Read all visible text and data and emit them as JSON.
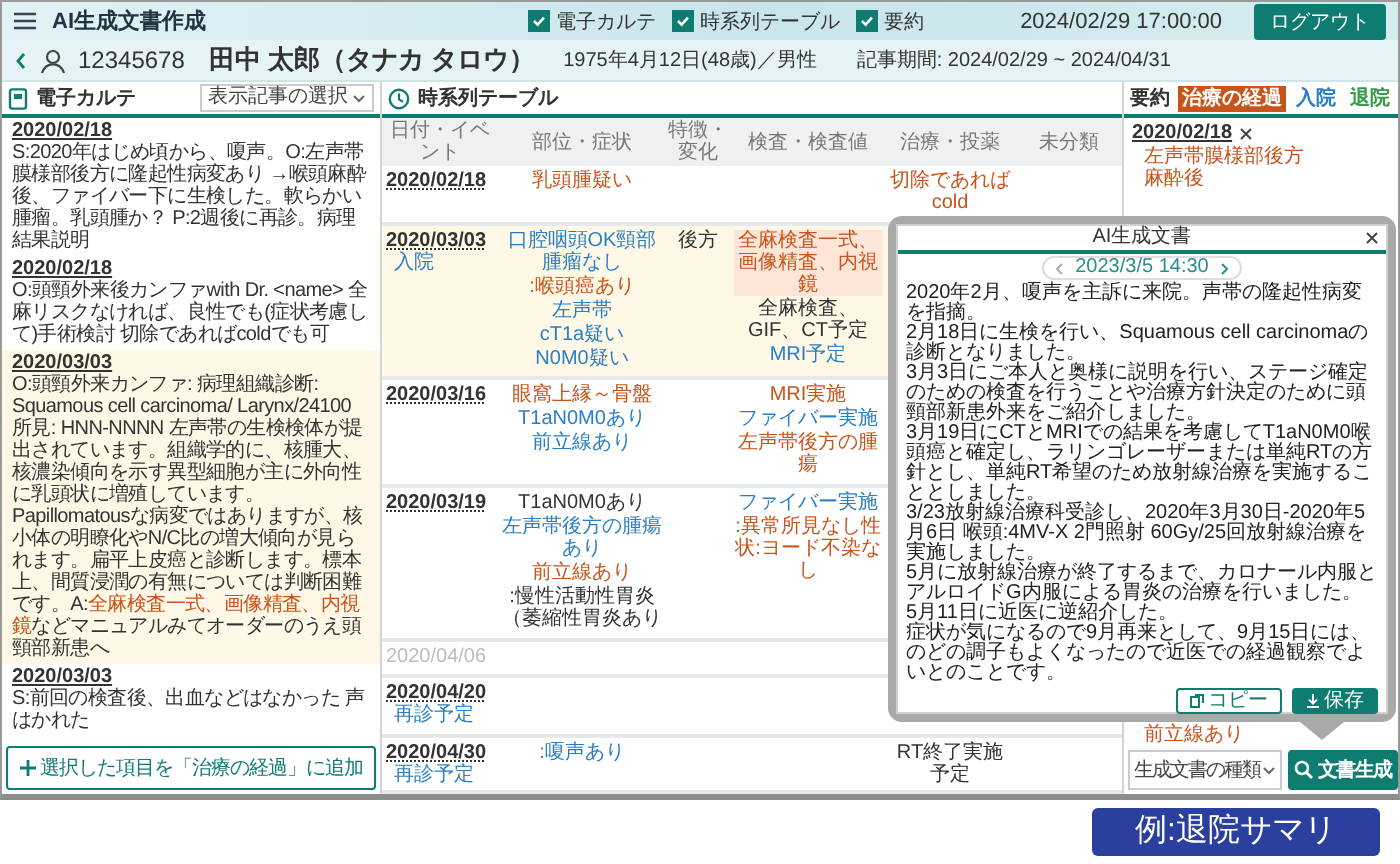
{
  "app_bar": {
    "title": "AI生成文書作成",
    "toggles": [
      {
        "label": "電子カルテ",
        "checked": true
      },
      {
        "label": "時系列テーブル",
        "checked": true
      },
      {
        "label": "要約",
        "checked": true
      }
    ],
    "datetime": "2024/02/29 17:00:00",
    "logout": "ログアウト"
  },
  "patient": {
    "id": "12345678",
    "name": "田中 太郎（タナカ タロウ）",
    "profile": "1975年4月12日(48歳)／男性",
    "period": "記事期間: 2024/02/29 ~ 2024/04/31"
  },
  "karte": {
    "title": "電子カルテ",
    "filter": "表示記事の選択",
    "entries": [
      {
        "date": "2020/02/18",
        "selected": false,
        "segments": [
          {
            "kind": "plain",
            "text": "S:2020年はじめ頃から、嗄声。O:左声帯膜様部後方に隆起性病変あり →喉頭麻酔後、ファイバー下に生検した。軟らかい腫瘤。乳頭腫か？ P:2週後に再診。病理結果説明"
          }
        ]
      },
      {
        "date": "2020/02/18",
        "selected": false,
        "segments": [
          {
            "kind": "plain",
            "text": "O:頭頸外来後カンファwith Dr. <name> 全麻リスクなければ、良性でも(症状考慮して)手術検討 切除であればcoldでも可"
          }
        ]
      },
      {
        "date": "2020/03/03",
        "selected": true,
        "segments": [
          {
            "kind": "plain",
            "text": "O:頭頸外来カンファ: 病理組織診断: Squamous cell carcinoma/ Larynx/24100 所見: HNN-NNNN 左声帯の生検検体が提出されています。組織学的に、核腫大、核濃染傾向を示す異型細胞が主に外向性に乳頭状に増殖しています。Papillomatousな病変ではありますが、核小体の明瞭化やN/C比の増大傾向が見られます。扁平上皮癌と診断します。標本上、間質浸潤の有無については判断困難です。A:"
          },
          {
            "kind": "alert",
            "text": "全麻検査一式、画像精査、内視鏡"
          },
          {
            "kind": "plain",
            "text": "などマニュアルみてオーダーのうえ頭頸部新患へ"
          }
        ]
      },
      {
        "date": "2020/03/03",
        "selected": false,
        "segments": [
          {
            "kind": "plain",
            "text": "S:前回の検査後、出血などはなかった 声はかれた"
          }
        ]
      }
    ],
    "add_button": "選択した項目を「治療の経過」に追加"
  },
  "timeline": {
    "title": "時系列テーブル",
    "columns": [
      "日付・イベント",
      "部位・症状",
      "特徴・変化",
      "検査・検査値",
      "治療・投薬",
      "未分類"
    ],
    "rows": [
      {
        "date": "2020/02/18",
        "selected": false,
        "faded": false,
        "site": [
          {
            "kind": "alert",
            "text": "乳頭腫疑い"
          }
        ],
        "treatment": [
          {
            "kind": "alert",
            "text": "切除であれば cold"
          }
        ]
      },
      {
        "date": "2020/03/03",
        "event": "入院",
        "selected": true,
        "faded": false,
        "site": [
          {
            "kind": "info",
            "text": "口腔咽頭OK頸部腫瘤なし"
          },
          {
            "kind": "alert",
            "text": ":喉頭癌あり"
          },
          {
            "kind": "info",
            "text": "左声帯"
          },
          {
            "kind": "info",
            "text": "cT1a疑い"
          },
          {
            "kind": "info",
            "text": "N0M0疑い"
          }
        ],
        "feature": [
          {
            "kind": "plain",
            "text": "後方"
          }
        ],
        "exam": [
          {
            "kind": "marked",
            "text": "全麻検査一式、画像精査、内視鏡"
          },
          {
            "kind": "plain",
            "text": "全麻検査、GIF、CT予定"
          },
          {
            "kind": "info",
            "text": "MRI予定"
          }
        ]
      },
      {
        "date": "2020/03/16",
        "selected": false,
        "faded": false,
        "site": [
          {
            "kind": "alert",
            "text": "眼窩上縁～骨盤"
          },
          {
            "kind": "info",
            "text": "T1aN0M0あり"
          },
          {
            "kind": "info",
            "text": "前立線あり"
          }
        ],
        "exam": [
          {
            "kind": "alert",
            "text": "MRI実施"
          },
          {
            "kind": "info",
            "text": "ファイバー実施"
          },
          {
            "kind": "alert",
            "text": "左声帯後方の腫瘍"
          }
        ]
      },
      {
        "date": "2020/03/19",
        "selected": false,
        "faded": false,
        "site": [
          {
            "kind": "plain",
            "text": "T1aN0M0あり"
          },
          {
            "kind": "info",
            "text": "左声帯後方の腫瘍あり"
          },
          {
            "kind": "alert",
            "text": "前立線あり"
          },
          {
            "kind": "plain",
            "text": ":慢性活動性胃炎（萎縮性胃炎あり"
          }
        ],
        "exam": [
          {
            "kind": "info",
            "text": "ファイバー実施"
          },
          {
            "kind": "alert",
            "text": ":異常所見なし性状:ヨード不染なし"
          }
        ]
      },
      {
        "date": "2020/04/06",
        "selected": false,
        "faded": true
      },
      {
        "date": "2020/04/20",
        "event": "再診予定",
        "selected": false,
        "faded": false
      },
      {
        "date": "2020/04/30",
        "event": "再診予定",
        "selected": false,
        "faded": false,
        "site": [
          {
            "kind": "info",
            "text": ":嗄声あり"
          }
        ],
        "treatment": [
          {
            "kind": "plain",
            "text": "RT終了実施予定"
          }
        ]
      }
    ]
  },
  "summary": {
    "title": "要約",
    "tabs": [
      {
        "label": "治療の経過",
        "selected": true,
        "color": "#c9541b"
      },
      {
        "label": "入院",
        "selected": false,
        "color": "#2a7fc4"
      },
      {
        "label": "退院",
        "selected": false,
        "color": "#3a9a4a"
      }
    ],
    "date": "2020/02/18",
    "items": [
      {
        "kind": "alert",
        "text": "左声帯膜様部後方"
      },
      {
        "kind": "alert",
        "text": "麻酔後"
      }
    ],
    "trailing_items": [
      {
        "kind": "alert",
        "text": "前立線あり"
      }
    ],
    "doc_type": "生成文書の種類",
    "generate": "文書生成"
  },
  "popup": {
    "title": "AI生成文書",
    "timestamp": "2023/3/5 14:30",
    "paragraphs": [
      "2020年2月、嗄声を主訴に来院。声帯の隆起性病変を指摘。",
      "2月18日に生検を行い、Squamous cell carcinomaの診断となりました。",
      "3月3日にご本人と奥様に説明を行い、ステージ確定のための検査を行うことや治療方針決定のために頭頸部新患外来をご紹介しました。",
      "3月19日にCTとMRIでの結果を考慮してT1aN0M0喉頭癌と確定し、ラリンゴレーザーまたは単純RTの方針とし、単純RT希望のため放射線治療を実施することとしました。",
      "3/23放射線治療科受診し、2020年3月30日-2020年5月6日 喉頭:4MV-X 2門照射 60Gy/25回放射線治療を実施しました。",
      "5月に放射線治療が終了するまで、カロナール内服とアルロイドG内服による胃炎の治療を行いました。",
      "5月11日に近医に逆紹介した。",
      "症状が気になるので9月再来として、9月15日には、のどの調子もよくなったので近医での経過観察でよいとのことです。"
    ],
    "buttons": [
      {
        "kind": "copy",
        "label": "コピー"
      },
      {
        "kind": "save",
        "label": "保存"
      }
    ]
  },
  "caption": "例:退院サマリ"
}
